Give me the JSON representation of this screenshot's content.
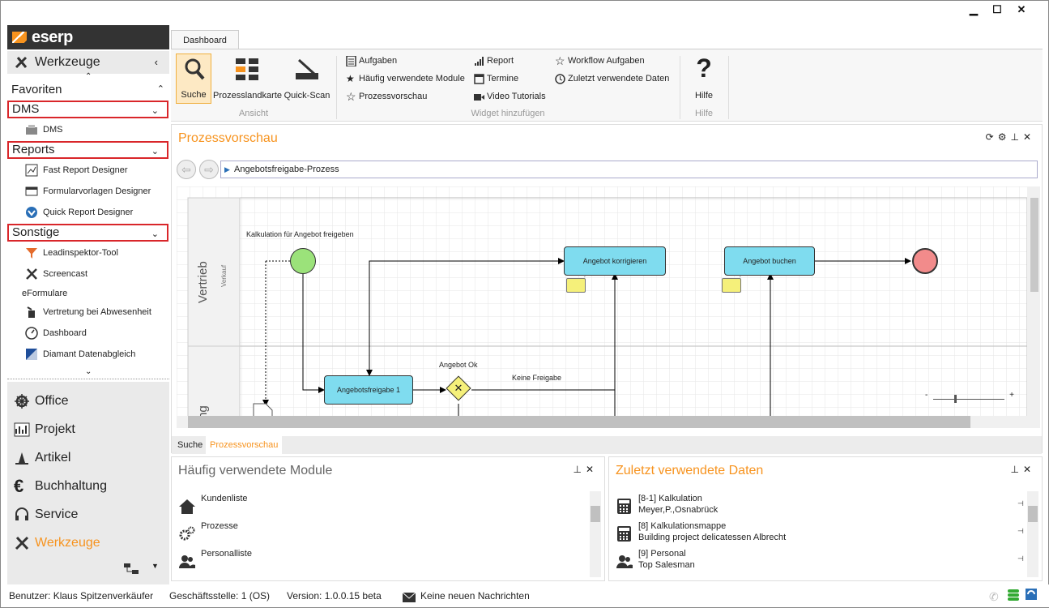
{
  "app": {
    "logo": "eserp"
  },
  "sidebar": {
    "header": "Werkzeuge",
    "favorites_label": "Favoriten",
    "sections": [
      {
        "label": "DMS",
        "items": [
          {
            "label": "DMS",
            "icon": "dms-icon"
          }
        ]
      },
      {
        "label": "Reports",
        "items": [
          {
            "label": "Fast Report Designer",
            "icon": "report-designer-icon"
          },
          {
            "label": "Formularvorlagen Designer",
            "icon": "form-template-icon"
          },
          {
            "label": "Quick Report Designer",
            "icon": "quick-report-icon"
          }
        ]
      },
      {
        "label": "Sonstige",
        "items": [
          {
            "label": "Leadinspektor-Tool",
            "icon": "lead-inspector-icon"
          },
          {
            "label": "Screencast",
            "icon": "tools-icon"
          },
          {
            "label": "eFormulare",
            "icon": ""
          },
          {
            "label": "Vertretung bei Abwesenheit",
            "icon": "substitute-icon"
          },
          {
            "label": "Dashboard",
            "icon": "dashboard-gauge-icon"
          },
          {
            "label": "Diamant Datenabgleich",
            "icon": "diamant-icon"
          }
        ]
      }
    ],
    "nav": [
      {
        "label": "Office",
        "icon": "ship-wheel-icon"
      },
      {
        "label": "Projekt",
        "icon": "project-chart-icon"
      },
      {
        "label": "Artikel",
        "icon": "article-icon"
      },
      {
        "label": "Buchhaltung",
        "icon": "euro-icon"
      },
      {
        "label": "Service",
        "icon": "headset-icon"
      },
      {
        "label": "Werkzeuge",
        "icon": "tools-icon"
      }
    ]
  },
  "ribbon": {
    "tab": "Dashboard",
    "ansicht": {
      "label": "Ansicht",
      "buttons": [
        "Suche",
        "Prozesslandkarte",
        "Quick-Scan"
      ]
    },
    "widget": {
      "label": "Widget hinzufügen",
      "col1": [
        "Aufgaben",
        "Häufig verwendete Module",
        "Prozessvorschau"
      ],
      "col2": [
        "Report",
        "Termine",
        "Video Tutorials"
      ],
      "col3": [
        "Workflow Aufgaben",
        "Zuletzt verwendete Daten"
      ]
    },
    "hilfe": {
      "label": "Hilfe",
      "button": "Hilfe"
    }
  },
  "process": {
    "title": "Prozessvorschau",
    "breadcrumb": "Angebotsfreigabe-Prozess",
    "lane1": "Vertrieb",
    "lane1_sub": "Verkauf",
    "lane2": "ng",
    "start_label": "Kalkulation für Angebot freigeben",
    "task1": "Angebotsfreigabe 1",
    "task2": "Angebot korrigieren",
    "task3": "Angebot buchen",
    "gateway_label": "Angebot Ok",
    "flow_label": "Keine Freigabe",
    "zoom_minus": "-",
    "zoom_plus": "+",
    "bottom_tabs": [
      "Suche",
      "Prozessvorschau"
    ]
  },
  "modules": {
    "title": "Häufig verwendete Module",
    "items": [
      {
        "label": "Kundenliste",
        "icon": "home-icon"
      },
      {
        "label": "Prozesse",
        "icon": "gears-icon"
      },
      {
        "label": "Personalliste",
        "icon": "people-icon"
      }
    ]
  },
  "recent": {
    "title": "Zuletzt verwendete Daten",
    "items": [
      {
        "line1": "[8-1] Kalkulation",
        "line2": "Meyer,P.,Osnabrück",
        "icon": "calculator-icon"
      },
      {
        "line1": "[8] Kalkulationsmappe",
        "line2": "Building project delicatessen Albrecht",
        "icon": "calculator-icon"
      },
      {
        "line1": "[9] Personal",
        "line2": "Top Salesman",
        "icon": "people-icon"
      }
    ]
  },
  "status": {
    "user": "Benutzer: Klaus Spitzenverkäufer",
    "branch": "Geschäftsstelle: 1 (OS)",
    "version": "Version: 1.0.0.15 beta",
    "messages": "Keine neuen Nachrichten"
  },
  "colors": {
    "accent": "#f7931e",
    "task": "#7fdcef",
    "start": "#9be27a",
    "end": "#f28b8b",
    "gateway": "#f5f07a"
  }
}
